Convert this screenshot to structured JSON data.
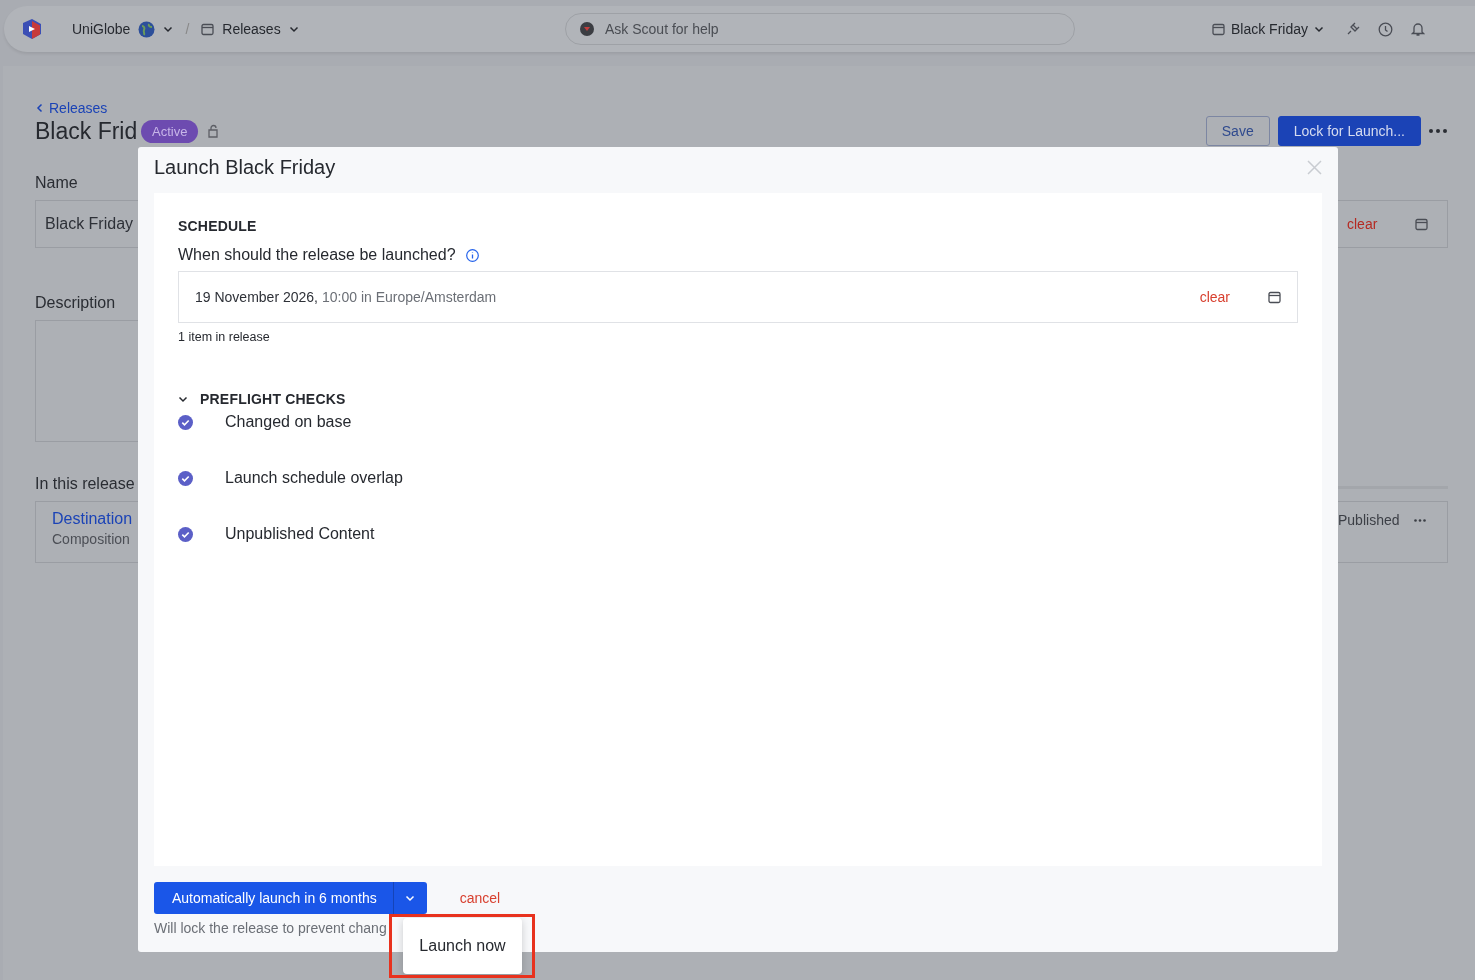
{
  "top_bar": {
    "workspace": "UniGlobe",
    "separator": "/",
    "section": "Releases",
    "search": {
      "placeholder": "Ask Scout for help"
    },
    "release_picker": "Black Friday"
  },
  "page": {
    "back_link": "Releases",
    "title": "Black Frid",
    "status_badge": "Active",
    "buttons": [
      {
        "label": "Save",
        "kind": "secondary",
        "disabled": true
      },
      {
        "label": "Lock for Launch...",
        "kind": "primary",
        "disabled": false
      }
    ],
    "name_label": "Name",
    "name_value": "Black Friday",
    "schedule_clear": "clear",
    "description_label": "Description",
    "items_label": "In this release",
    "item": {
      "title": "Destination",
      "type": "Composition",
      "status": "Published"
    }
  },
  "modal": {
    "title": "Launch Black Friday",
    "schedule_heading": "SCHEDULE",
    "question": "When should the release be launched?",
    "date": "19 November 2026,",
    "time": "10:00 in Europe/Amsterdam",
    "clear": "clear",
    "item_count": "1 item in release",
    "checks_heading": "PREFLIGHT CHECKS",
    "checks_expanded": true,
    "checks": [
      {
        "label": "Changed on base",
        "passed": true
      },
      {
        "label": "Launch schedule overlap",
        "passed": true
      },
      {
        "label": "Unpublished Content",
        "passed": true
      }
    ],
    "primary_action": "Automatically launch in 6 months",
    "cancel": "cancel",
    "hint": "Will lock the release to prevent chang"
  },
  "menu": {
    "items": [
      {
        "label": "Launch now"
      }
    ]
  }
}
